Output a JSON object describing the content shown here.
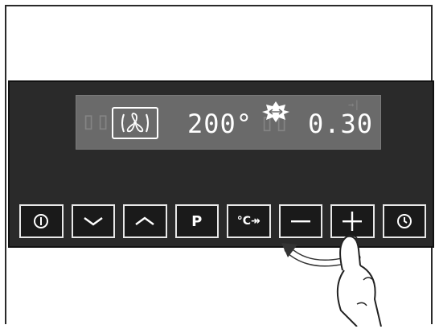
{
  "display": {
    "temperature": "200°",
    "timer": "0.30",
    "fan_mode": "fan-icon",
    "boost": "rapid-preheat-icon"
  },
  "buttons": [
    {
      "name": "power-button",
      "label": "",
      "icon": "power-icon"
    },
    {
      "name": "down-button",
      "label": "",
      "icon": "chevron-down-icon"
    },
    {
      "name": "up-button",
      "label": "",
      "icon": "chevron-up-icon"
    },
    {
      "name": "program-button",
      "label": "P",
      "icon": ""
    },
    {
      "name": "temperature-button",
      "label": "°C↠",
      "icon": ""
    },
    {
      "name": "minus-button",
      "label": "",
      "icon": "minus-icon"
    },
    {
      "name": "plus-button",
      "label": "",
      "icon": "plus-icon"
    },
    {
      "name": "clock-button",
      "label": "",
      "icon": "clock-icon"
    }
  ],
  "colors": {
    "panel": "#2a2a2a",
    "display": "#6a6a6a",
    "segment": "#ffffff"
  }
}
